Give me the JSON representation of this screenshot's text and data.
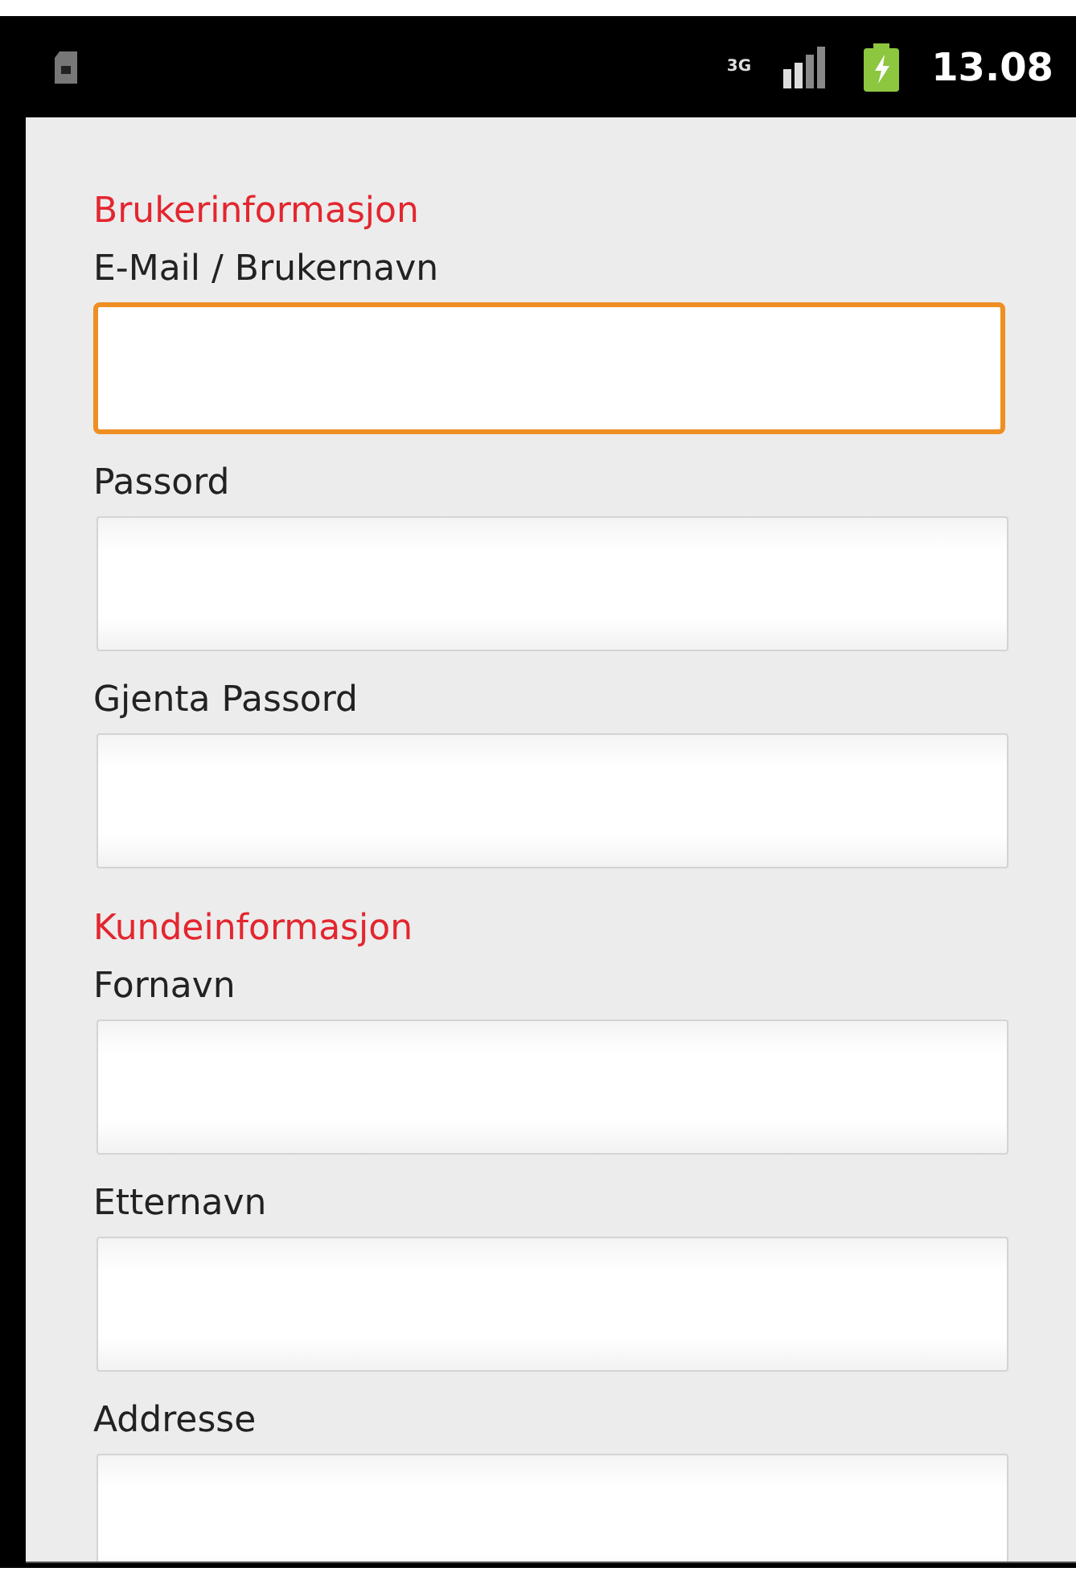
{
  "status_bar": {
    "network": "3G",
    "time": "13.08"
  },
  "sections": [
    {
      "title": "Brukerinformasjon",
      "fields": [
        {
          "label": "E-Mail / Brukernavn",
          "focused": true
        },
        {
          "label": "Passord",
          "focused": false
        },
        {
          "label": "Gjenta Passord",
          "focused": false
        }
      ]
    },
    {
      "title": "Kundeinformasjon",
      "fields": [
        {
          "label": "Fornavn",
          "focused": false
        },
        {
          "label": "Etternavn",
          "focused": false
        },
        {
          "label": "Addresse",
          "focused": false
        }
      ]
    }
  ]
}
